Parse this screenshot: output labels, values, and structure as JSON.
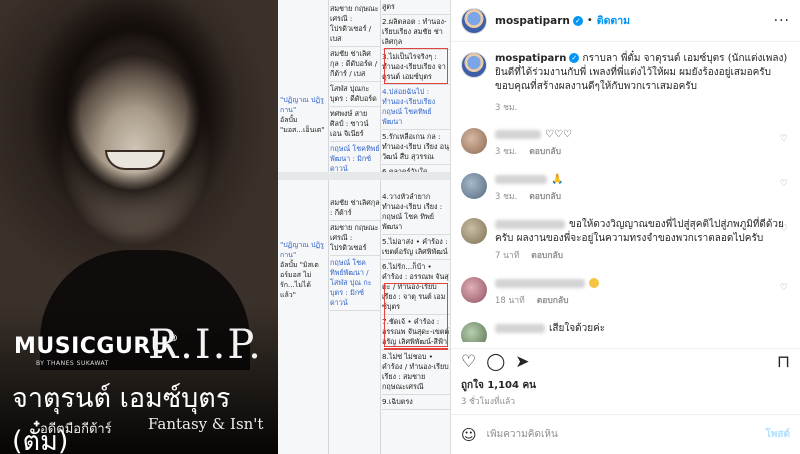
{
  "photo": {
    "brand": "MUSICGURU",
    "brand_sub": "BY THANES SUKAWAT",
    "rip": "R.I.P.",
    "name": "จาตุรนต์ เอมซ์บุตร (ตั๋ม)",
    "role": "อดีตมือกีต้าร์",
    "songs": "Fantasy & Isn't"
  },
  "doc": {
    "quote1": "\"ปฏิญาณ ปฏิรู กาน\"",
    "quote1b": "อัลบั้ม \"มอส...เอ็นเต\"",
    "quote2": "\"ปฏิญาณ ปฏิรู กาน\"",
    "quote2b": "อัลบั้ม \"มิสเตอร์มอส ไม่รัก...ไม่ได้ แล้ว\"",
    "top_col1": [
      "สมชาย กฤษณะ เศรณี : โปรดิวเซอร์ / เบส",
      "สมชัย ช่าเลิศ กุล : ดีดับอร์ด / กีต้าร์ / เบส",
      "โสฬส ปุณกะ บุตร : ดีดับอร์ด",
      "ทศพงษ์ สาย ศิลป์ : ซาวน์เอน จิเนียร์",
      "กฤษณ์ โชคทิพย์ พัฒนา : มิกซ์ดาวน์"
    ],
    "top_col2": [
      "สูตร",
      "2.ผลิตลอต : ทำนอง-เรียบเรียง สมชัย ช่าเลิศกุล",
      "3.ไม่เป็นไรจริงๆ : ทำนอง-เรียบเรียง จาตุรนต์ เอมซ์บุตร",
      "4.ปล่อยฉันไป : ทำนอง-เรียบเรียง กฤษณ์ โชคทิพย์ พัฒนา",
      "5.รักเหลือเกน กล : ทำนอง-เรียบ เรียง อนุวัฒน์ สืบ สุวรรณ",
      "6.ตลาดร์วันใด"
    ],
    "bot_col1": [
      "สมชัย ช่าเลิศกุล : กีต้าร์",
      "สมชาย กฤษณะ เศรณี : โปรดิวเซอร์",
      "กฤษณ์ โชค ทิพย์พัฒนา / โสฬส ปุณ กะบุตร : มิกซ์ดาวน์"
    ],
    "bot_col2": [
      "4.วางหัวลำยาก ทำนอง-เรียบ เรียง : กฤษณ์ โชค ทิพย์พัฒนา",
      "5.ไม่อาส่ง • คำร้อง : เขตต์อรัญ เลิศพิพัฒน์",
      "6.ไม่รัก...ก็บ้า • คำร้อง : อรรณพ จันสุดะ / ทำนอง-เรียบเรียง : จาตุ รนต์ เอมซ์บุตร",
      "7.ชัดเจ้ • คำร้อง : อรรณพ จันสุดะ-เขตต์อรัญ เลิศพิพัฒน์-สีฟ้า",
      "8.ไม่ซ่ ไม่ชอบ • คำร้อง / ทำนอง-เรียบเรียง : สมชาย กฤษณะเศรณี",
      "9.เฉิบตรง"
    ]
  },
  "ig": {
    "username": "mospatiparn",
    "follow": "ติดตาม",
    "more": "···",
    "caption": "กราบลา พี่ตั๋ม จาตุรนต์ เอมซ์บุตร (นักแต่งเพลง) ยินดีที่ได้ร่วมงานกับพี่ เพลงที่พี่แต่งไว้ให้ผม ผมยังร้องอยู่เสมอครับ ขอบคุณที่สร้างผลงานดีๆให้กับพวกเราเสมอครับ",
    "caption_time": "3 ชม.",
    "comments": [
      {
        "text": "♡♡♡",
        "time": "3 ชม.",
        "reply": "ตอบกลับ"
      },
      {
        "text": "🙏",
        "time": "3 ชม.",
        "reply": "ตอบกลับ"
      },
      {
        "text": "ขอให้ดวงวิญญาณของพี่ไปสู่สุคติไปสู่ภพภูมิที่ดีด้วยครับ ผลงานของพี่จะอยู่ในความทรงจำของพวกเราตลอดไปครับ",
        "time": "7 นาที",
        "reply": "ตอบกลับ"
      },
      {
        "text": "",
        "time": "18 นาที",
        "reply": "ตอบกลับ"
      },
      {
        "text": "เสียใจด้วยค่ะ",
        "time": "",
        "reply": ""
      }
    ],
    "likes": "ถูกใจ 1,104 คน",
    "post_time": "3 ชั่วโมงที่แล้ว",
    "comment_placeholder": "เพิ่มความคิดเห็น",
    "post_label": "โพสต์"
  }
}
